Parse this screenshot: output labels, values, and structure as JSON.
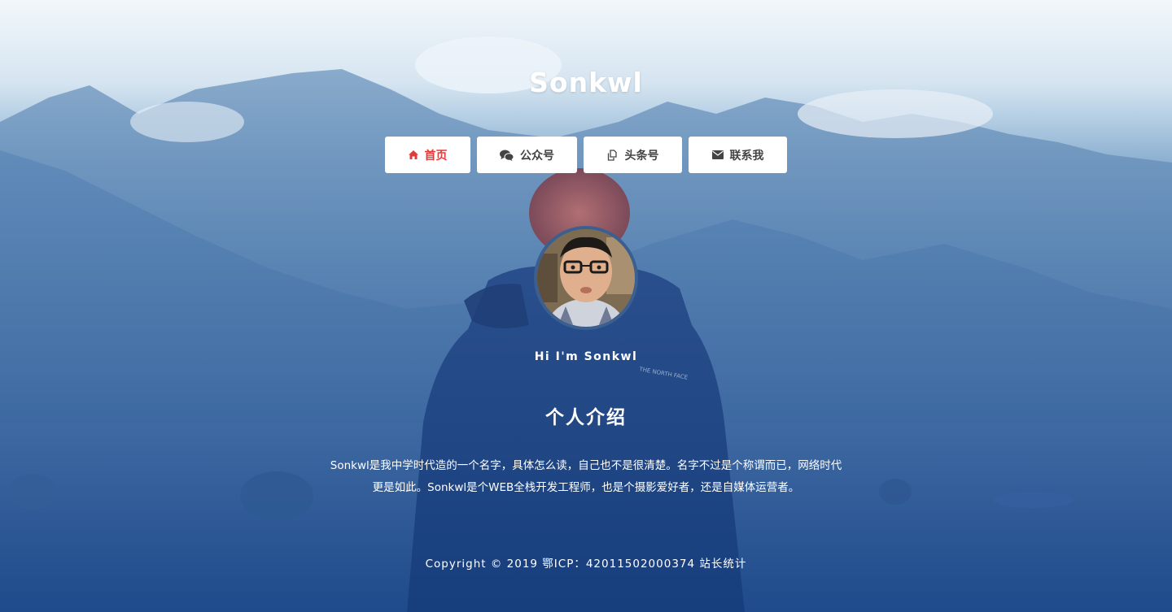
{
  "site": {
    "title": "Sonkwl"
  },
  "nav": {
    "items": [
      {
        "label": "首页",
        "icon": "home-icon",
        "active": true
      },
      {
        "label": "公众号",
        "icon": "wechat-icon",
        "active": false
      },
      {
        "label": "头条号",
        "icon": "copy-icon",
        "active": false
      },
      {
        "label": "联系我",
        "icon": "envelope-icon",
        "active": false
      }
    ]
  },
  "profile": {
    "greeting": "Hi I'm Sonkwl"
  },
  "about": {
    "title": "个人介绍",
    "text": "Sonkwl是我中学时代造的一个名字，具体怎么读，自己也不是很清楚。名字不过是个称谓而已，网络时代更是如此。Sonkwl是个WEB全栈开发工程师，也是个摄影爱好者，还是自媒体运营者。"
  },
  "footer": {
    "copyright": "Copyright © 2019",
    "icp": "鄂ICP：42011502000374",
    "stats": "站长统计"
  },
  "colors": {
    "active_nav": "#e03b3b",
    "nav_text": "#444444",
    "text": "#ffffff"
  }
}
